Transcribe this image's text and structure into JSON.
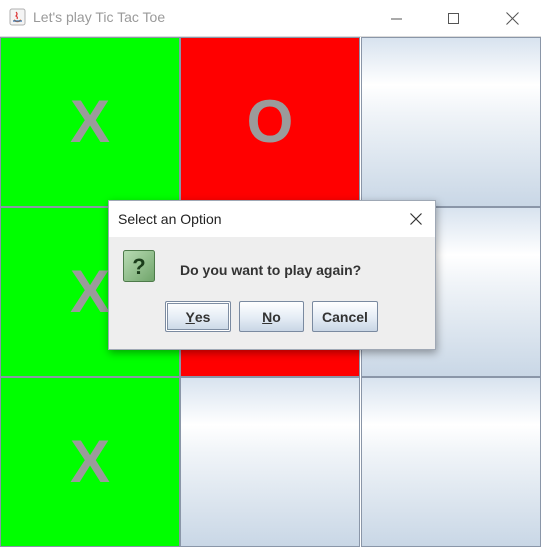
{
  "window": {
    "title": "Let's play Tic Tac Toe",
    "controls": [
      "minimize-icon",
      "maximize-icon",
      "close-icon"
    ]
  },
  "board": {
    "cells": [
      {
        "mark": "X",
        "color": "#00ff00"
      },
      {
        "mark": "O",
        "color": "#ff0000"
      },
      {
        "mark": "",
        "color": "blank"
      },
      {
        "mark": "X",
        "color": "#00ff00"
      },
      {
        "mark": "",
        "color": "#ff0000"
      },
      {
        "mark": "",
        "color": "blank"
      },
      {
        "mark": "X",
        "color": "#00ff00"
      },
      {
        "mark": "",
        "color": "blank"
      },
      {
        "mark": "",
        "color": "blank"
      }
    ]
  },
  "dialog": {
    "title": "Select an Option",
    "message": "Do you want to play again?",
    "icon": "question-icon",
    "buttons": {
      "yes_mnemonic": "Y",
      "yes_rest": "es",
      "no_mnemonic": "N",
      "no_rest": "o",
      "cancel": "Cancel"
    }
  }
}
